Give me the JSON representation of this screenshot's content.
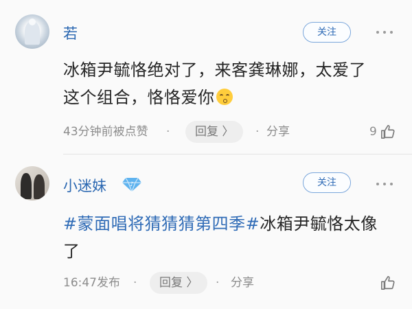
{
  "comments": [
    {
      "username": "若",
      "follow_label": "关注",
      "text_lines": [
        "冰箱尹毓恪绝对了，来客龚琳娜，太爱了",
        "这个组合，恪恪爱你"
      ],
      "emoji": "kissing-face",
      "time": "43分钟前被点赞",
      "reply_label": "回复 〉",
      "share_label": "分享",
      "like_count": "9"
    },
    {
      "username": "小迷妹",
      "badge": "diamond-vip",
      "follow_label": "关注",
      "topic": "#蒙面唱将猜猜猜第四季#",
      "text_line1_rest": "冰箱尹毓恪太像",
      "text_line2": "了",
      "time": "16:47发布",
      "reply_label": "回复 〉",
      "share_label": "分享",
      "like_count": ""
    }
  ],
  "dot": "·",
  "colors": {
    "link": "#2a67b1",
    "muted": "#8c8c8c",
    "background": "#fafafa"
  }
}
